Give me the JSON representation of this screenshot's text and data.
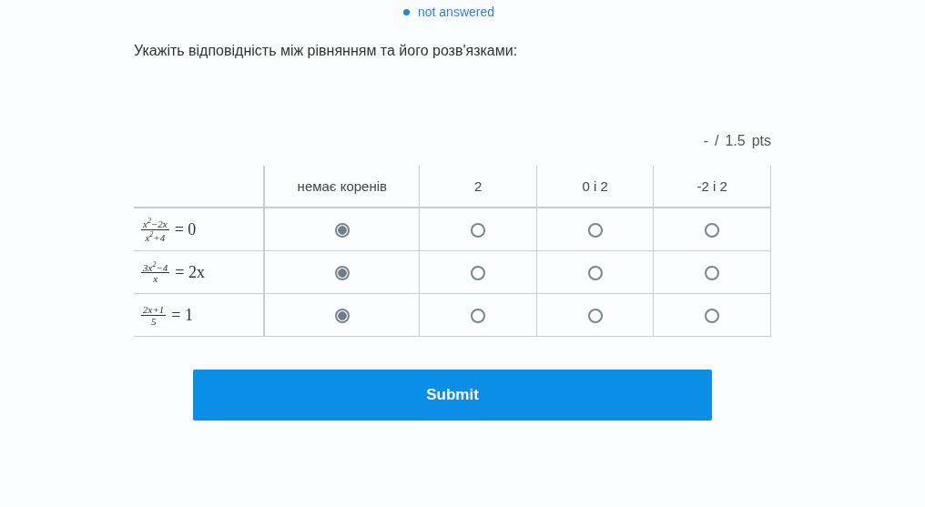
{
  "status": {
    "label": "not answered",
    "color": "#1a8ad6"
  },
  "question": "Укажіть відповідність між рівнянням та його розв'язками:",
  "score": {
    "earned": "-",
    "separator": "/",
    "total": "1.5",
    "unit": "pts"
  },
  "table": {
    "columns": [
      "немає коренів",
      "2",
      "0 і 2",
      "-2 і 2"
    ],
    "rows": [
      {
        "equation": {
          "numerator": "x$^{2}$−2x",
          "denominator": "x$^{2}$+4",
          "rhs": "= 0"
        },
        "choices": [
          {
            "selected": true
          },
          {
            "selected": false
          },
          {
            "selected": false
          },
          {
            "selected": false
          }
        ]
      },
      {
        "equation": {
          "numerator": "3x$^{2}$−4",
          "denominator": "x",
          "rhs": "= 2x"
        },
        "choices": [
          {
            "selected": true
          },
          {
            "selected": false
          },
          {
            "selected": false
          },
          {
            "selected": false
          }
        ]
      },
      {
        "equation": {
          "numerator": "2x+1",
          "denominator": "5",
          "rhs": "= 1"
        },
        "choices": [
          {
            "selected": true
          },
          {
            "selected": false
          },
          {
            "selected": false
          },
          {
            "selected": false
          }
        ]
      }
    ]
  },
  "submit": "Submit"
}
